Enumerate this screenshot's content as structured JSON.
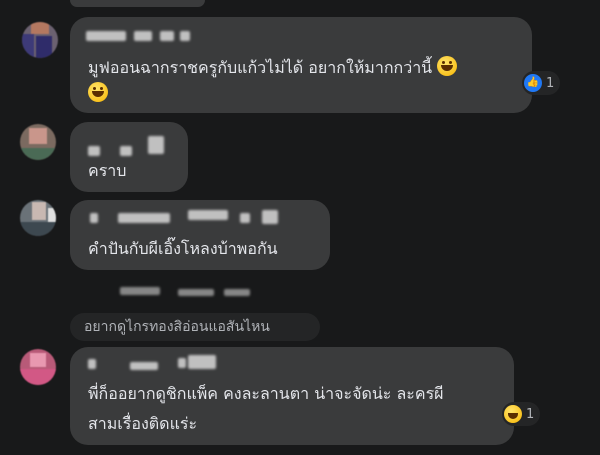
{
  "comments": [
    {
      "text_line1": "มูฟออนฉากราชครูกับแก้วไม่ได้ อยากให้มากกว่านี้",
      "text_line2": "",
      "reaction": {
        "icon": "like-icon",
        "count": "1"
      }
    },
    {
      "text_line1": "คราบ"
    },
    {
      "text_line1": "คำปันกับผีเอิ๊งโหลงบ้าพอกัน"
    },
    {
      "reply_quote": "อยากดูไกรทองสิอ่อนแอสันไหน",
      "text_line1": "พี่ก็ออยากดูชิกแพ็ค คงละลานตา น่าจะจัดน่ะ ละครผี",
      "text_line2": "สามเรื่องติดแร่ะ",
      "reaction": {
        "icon": "haha-icon",
        "count": "1"
      }
    }
  ],
  "colors": {
    "background": "#18191a",
    "bubble": "#3a3b3c",
    "text": "#e4e6eb",
    "like_blue": "#2078f4"
  }
}
